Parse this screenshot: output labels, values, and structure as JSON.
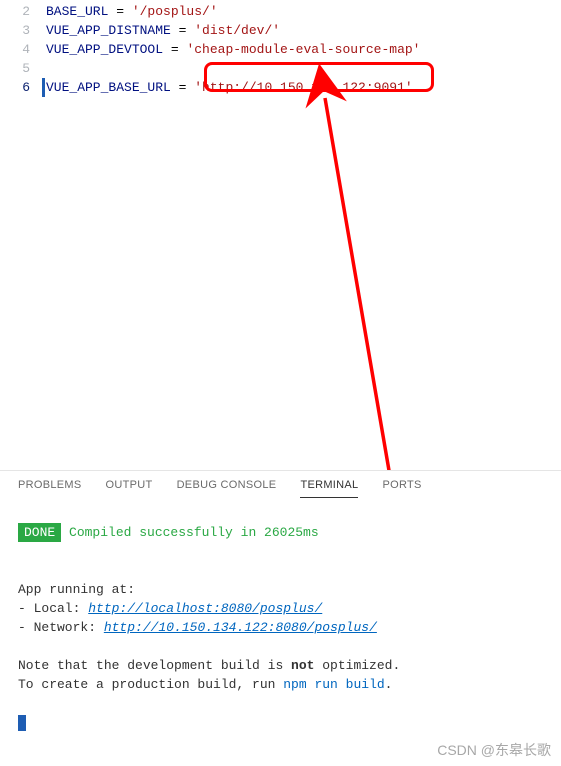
{
  "editor": {
    "lines": [
      {
        "num": "2",
        "var": "BASE_URL",
        "eq": " = ",
        "str": "'/posplus/'",
        "partial_top": true
      },
      {
        "num": "3",
        "var": "VUE_APP_DISTNAME",
        "eq": " = ",
        "str": "'dist/dev/'"
      },
      {
        "num": "4",
        "var": "VUE_APP_DEVTOOL",
        "eq": " = ",
        "str": "'cheap-module-eval-source-map'"
      },
      {
        "num": "5",
        "var": "",
        "eq": "",
        "str": ""
      },
      {
        "num": "6",
        "var": "VUE_APP_BASE_URL",
        "eq": " = ",
        "str": "'http://10.150.134.122:9091'",
        "active": true
      }
    ]
  },
  "panel": {
    "tabs": {
      "problems": "PROBLEMS",
      "output": "OUTPUT",
      "debug": "DEBUG CONSOLE",
      "terminal": "TERMINAL",
      "ports": "PORTS"
    },
    "done_badge": " DONE ",
    "compiled_msg": " Compiled successfully in 26025ms",
    "app_running": " App running at:",
    "local_label": " - Local:   ",
    "local_url": "http://localhost:8080/posplus/",
    "network_label": " - Network: ",
    "network_url": "http://10.150.134.122:8080/posplus/",
    "note_line1_a": " Note that the development build is ",
    "note_line1_b": "not",
    "note_line1_c": " optimized.",
    "note_line2_a": " To create a production build, run ",
    "note_line2_b": "npm run build",
    "note_line2_c": "."
  },
  "watermark": "CSDN @东皋长歌"
}
